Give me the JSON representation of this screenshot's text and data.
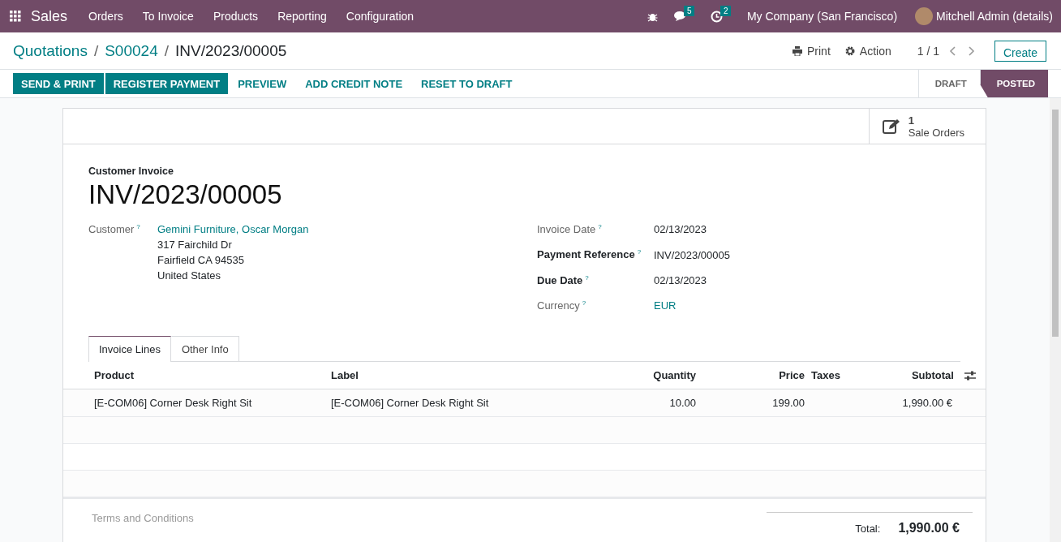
{
  "navbar": {
    "app": "Sales",
    "menu": [
      "Orders",
      "To Invoice",
      "Products",
      "Reporting",
      "Configuration"
    ],
    "messages_badge": "5",
    "activities_badge": "2",
    "company": "My Company (San Francisco)",
    "user": "Mitchell Admin (details)"
  },
  "breadcrumb": [
    {
      "label": "Quotations"
    },
    {
      "separator": "/",
      "label": "S00024"
    },
    {
      "separator": "/",
      "label": "INV/2023/00005"
    }
  ],
  "actions": {
    "print": "Print",
    "action": "Action",
    "pager": "1 / 1",
    "create": "Create"
  },
  "buttons": [
    {
      "label": "SEND & PRINT",
      "kind": "primary"
    },
    {
      "label": "REGISTER PAYMENT",
      "kind": "primary"
    },
    {
      "label": "PREVIEW",
      "kind": "link"
    },
    {
      "label": "ADD CREDIT NOTE",
      "kind": "link"
    },
    {
      "label": "RESET TO DRAFT",
      "kind": "link"
    }
  ],
  "status": [
    {
      "label": "DRAFT",
      "selected": false
    },
    {
      "label": "POSTED",
      "selected": true
    }
  ],
  "smart_button": {
    "count": "1",
    "label": "Sale Orders"
  },
  "document": {
    "type": "Customer Invoice",
    "number": "INV/2023/00005"
  },
  "customer": {
    "label": "Customer",
    "help": "?",
    "name": "Gemini Furniture, Oscar Morgan",
    "address": [
      "317 Fairchild Dr",
      "Fairfield CA 94535",
      "United States"
    ]
  },
  "fields": [
    {
      "label": "Invoice Date",
      "help": "?",
      "value": "02/13/2023",
      "required": false,
      "link": false
    },
    {
      "label": "Payment Reference",
      "help": "?",
      "value": "INV/2023/00005",
      "required": true,
      "link": false
    },
    {
      "label": "Due Date",
      "help": "?",
      "value": "02/13/2023",
      "required": true,
      "link": false
    },
    {
      "label": "Currency",
      "help": "?",
      "value": "EUR",
      "required": false,
      "link": true
    }
  ],
  "tabs": [
    {
      "label": "Invoice Lines",
      "selected": true
    },
    {
      "label": "Other Info",
      "selected": false
    }
  ],
  "table": {
    "columns": [
      "Product",
      "Label",
      "Quantity",
      "Price",
      "Taxes",
      "Subtotal"
    ],
    "rows": [
      [
        "[E-COM06] Corner Desk Right Sit",
        "[E-COM06] Corner Desk Right Sit",
        "10.00",
        "199.00",
        "",
        "1,990.00 €"
      ]
    ]
  },
  "terms_placeholder": "Terms and Conditions",
  "total": {
    "label": "Total:",
    "value": "1,990.00 €"
  }
}
